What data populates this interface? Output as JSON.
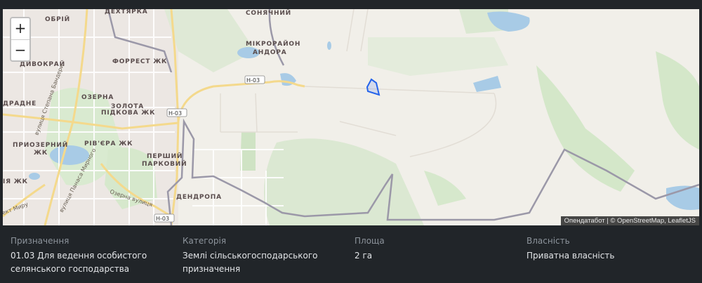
{
  "map": {
    "zoom_in": "+",
    "zoom_out": "−",
    "attribution_osm": "Опендатабот",
    "attribution_sep": " | © ",
    "attribution_rest": "OpenStreetMap, LeafletJS",
    "labels": {
      "obrii": "ОБРІЙ",
      "dekhtiarka": "ДЕХТЯРКА",
      "soniachnyi": "СОНЯЧНИЙ",
      "mikroraion": "МІКРОРАЙОН",
      "andora": "АНДОРА",
      "dyvokrai": "ДИВОКРАЙ",
      "forrest": "ФОРРЕСТ ЖК",
      "ozerna": "ОЗЕРНА",
      "zolota": "ЗОЛОТА",
      "pidkova": "ПІДКОВА ЖК",
      "dradne": "ДРАДНЕ",
      "pryozernyi": "ПРИОЗЕРНИЙ",
      "zhk": "ЖК",
      "rivera": "РІВ'ЄРА ЖК",
      "pershyi": "ПЕРШИЙ",
      "parkovyi": "ПАРКОВИЙ",
      "dendropa": "ДЕНДРОПА",
      "ia_zhk": "ІЯ ЖК",
      "road_n03_a": "Н-03",
      "road_n03_b": "Н-03",
      "road_n03_c": "Н-03",
      "street_bandery": "вулиця Степана Бандери",
      "street_myrnoho": "вулиця Панаса Мирного",
      "street_ozerna": "Озерна вулиця",
      "street_myru": "ект Миру"
    }
  },
  "info": {
    "purpose_label": "Призначення",
    "purpose_line1": "01.03 Для ведення особистого",
    "purpose_line2": "селянського господарства",
    "category_label": "Категорія",
    "category_line1": "Землі сільськогосподарського",
    "category_line2": "призначення",
    "area_label": "Площа",
    "area_value": "2 га",
    "ownership_label": "Власність",
    "ownership_value": "Приватна власність"
  }
}
